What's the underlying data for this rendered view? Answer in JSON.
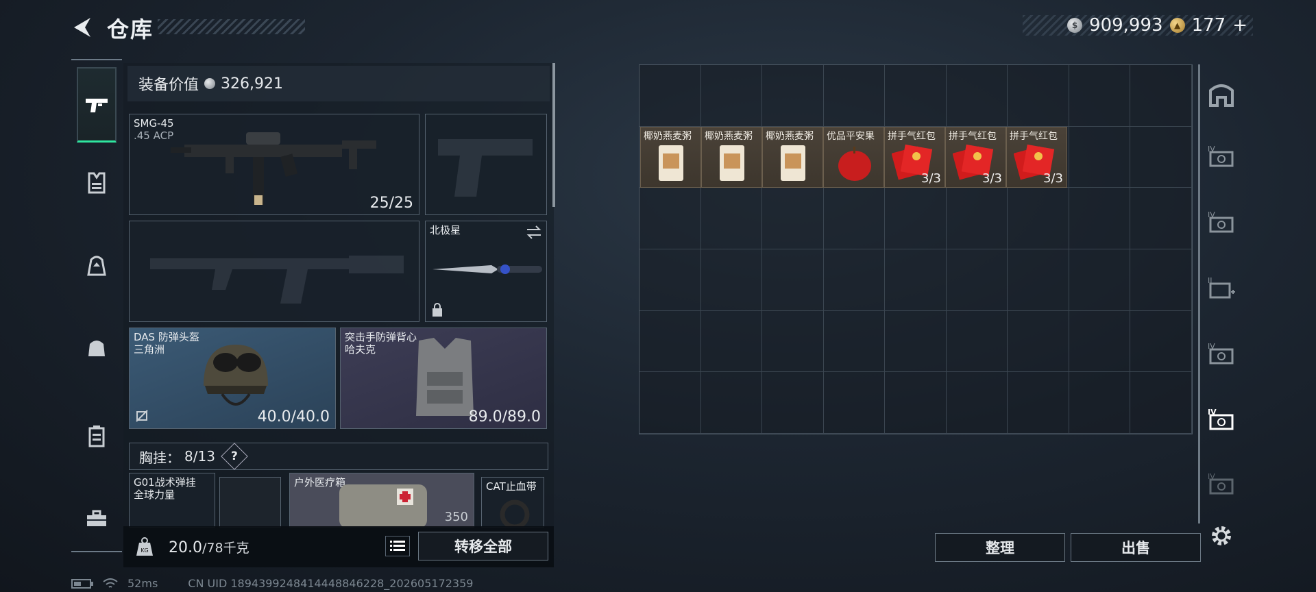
{
  "header": {
    "title": "仓库",
    "currency_silver": "909,993",
    "currency_gold": "177",
    "gold_plus": "+"
  },
  "left_nav": {
    "items": [
      "weapons-icon",
      "armor-icon",
      "backpack-icon",
      "bag-icon",
      "locker-icon",
      "toolbox-icon"
    ]
  },
  "equipment": {
    "value_label": "装备价值",
    "value": "326,921",
    "primary": {
      "name": "SMG-45",
      "sub": ".45 ACP",
      "ammo": "25/25"
    },
    "melee": {
      "name": "北极星"
    },
    "helmet": {
      "name": "DAS 防弹头盔",
      "sub": "三角洲",
      "durability": "40.0/40.0"
    },
    "vest": {
      "name": "突击手防弹背心",
      "sub": "哈夫克",
      "durability": "89.0/89.0"
    },
    "rig": {
      "label": "胸挂：",
      "capacity": "8/13",
      "help": "?"
    },
    "rig_items": [
      {
        "name": "G01战术弹挂",
        "sub": "全球力量"
      },
      {
        "name": "户外医疗箱",
        "value": "350"
      },
      {
        "name": "CAT止血带"
      }
    ]
  },
  "bottom": {
    "weight": "20.0",
    "weight_max": "/78千克",
    "transfer_all": "转移全部"
  },
  "storage": {
    "items": [
      {
        "name": "椰奶燕麦粥",
        "count": ""
      },
      {
        "name": "椰奶燕麦粥",
        "count": ""
      },
      {
        "name": "椰奶燕麦粥",
        "count": ""
      },
      {
        "name": "优品平安果",
        "count": ""
      },
      {
        "name": "拼手气红包",
        "count": "3/3"
      },
      {
        "name": "拼手气红包",
        "count": "3/3"
      },
      {
        "name": "拼手气红包",
        "count": "3/3"
      }
    ],
    "sort_button": "整理",
    "sell_button": "出售"
  },
  "right_rail": {
    "tabs": [
      "home-icon",
      "case-iv",
      "case-iv",
      "case-ii-add",
      "case-iv",
      "case-iv-active",
      "case-iv",
      "settings-icon"
    ]
  },
  "status": {
    "ping": "52ms",
    "uid": "CN UID 1894399248414448846228_202605172359"
  }
}
